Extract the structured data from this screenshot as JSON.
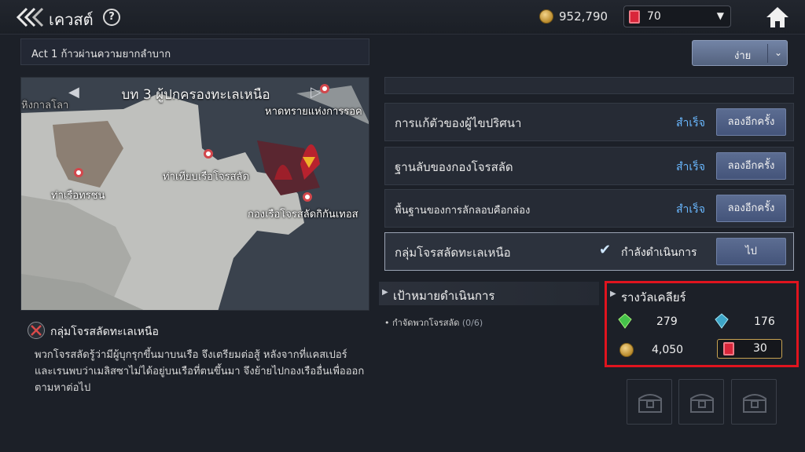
{
  "header": {
    "title": "เควสต์",
    "help": "?",
    "gold": "952,790",
    "gems": "70"
  },
  "act": {
    "label": "Act 1 ก้าวผ่านความยากลำบาก",
    "difficulty": "ง่าย"
  },
  "map": {
    "chapter_title": "บท 3 ผู้ปกครองทะเลเหนือ",
    "labels": {
      "top_left": "หิงกาลโลา",
      "top_right": "หาดทรายแห่งการรอค",
      "port": "ท่าเรือทรชน",
      "pirate_pier": "ท่าเทียบเรือโจรสลัด",
      "fleet": "กองเรือโจรสลัดกิกันเทอส"
    }
  },
  "quest_detail": {
    "name": "กลุ่มโจรสลัดทะเลเหนือ",
    "description": "พวกโจรสลัดรู้ว่ามีผู้บุกรุกขึ้นมาบนเรือ จึงเตรียมต่อสู้ หลังจากที่แคสเปอร์และเรนพบว่าเมลิสซาไม่ได้อยู่บนเรือที่ตนขึ้นมา จึงย้ายไปกองเรืออื่นเพื่อออกตามหาต่อไป"
  },
  "quests": [
    {
      "title": "การแก้ตัวของผู้ไขปริศนา",
      "status": "สำเร็จ",
      "button": "ลองอีกครั้ง"
    },
    {
      "title": "ฐานลับของกองโจรสลัด",
      "status": "สำเร็จ",
      "button": "ลองอีกครั้ง"
    },
    {
      "title": "พื้นฐานของการลักลอบคือกล่อง",
      "status": "สำเร็จ",
      "button": "ลองอีกครั้ง"
    }
  ],
  "active_quest": {
    "title": "กลุ่มโจรสลัดทะเลเหนือ",
    "status": "กำลังดำเนินการ",
    "button": "ไป"
  },
  "objectives": {
    "title": "เป้าหมายดำเนินการ",
    "item": "กำจัดพวกโจรสลัด",
    "count": "(0/6)"
  },
  "rewards": {
    "title": "รางวัลเคลียร์",
    "green_crystal": "279",
    "blue_crystal": "176",
    "gold": "4,050",
    "gems": "30"
  },
  "colors": {
    "highlight": "#e0141e",
    "status_blue": "#6ab8ff",
    "button_blue": "#4f5f85"
  }
}
